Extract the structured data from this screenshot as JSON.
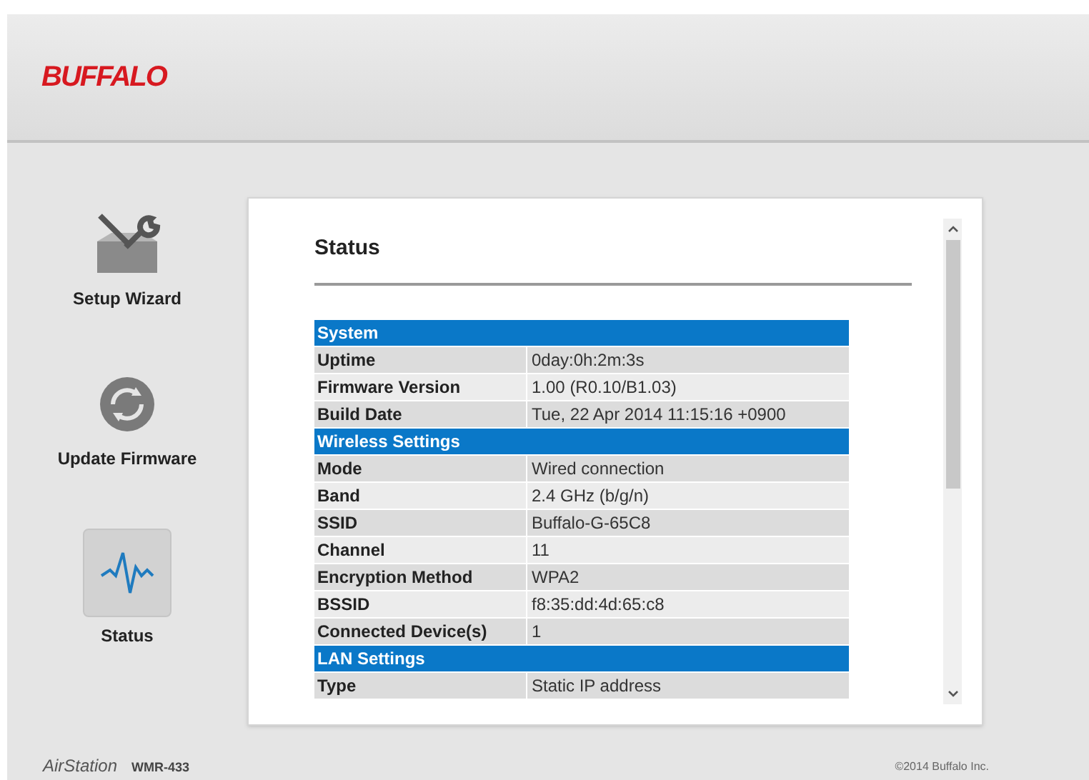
{
  "header": {
    "logo": "BUFFALO"
  },
  "sidebar": {
    "items": [
      {
        "label": "Setup Wizard",
        "kind": "wizard",
        "selected": false
      },
      {
        "label": "Update Firmware",
        "kind": "firmware",
        "selected": false
      },
      {
        "label": "Status",
        "kind": "status",
        "selected": true
      }
    ]
  },
  "content": {
    "title": "Status",
    "table": {
      "rows": [
        {
          "kind": "section",
          "label": "System"
        },
        {
          "kind": "item",
          "label": "Uptime",
          "value": "0day:0h:2m:3s"
        },
        {
          "kind": "item",
          "label": "Firmware Version",
          "value": "1.00 (R0.10/B1.03)"
        },
        {
          "kind": "item",
          "label": "Build Date",
          "value": "Tue, 22 Apr 2014 11:15:16 +0900"
        },
        {
          "kind": "section",
          "label": "Wireless Settings"
        },
        {
          "kind": "item",
          "label": "Mode",
          "value": "Wired connection"
        },
        {
          "kind": "item",
          "label": "Band",
          "value": "2.4 GHz (b/g/n)"
        },
        {
          "kind": "item",
          "label": "SSID",
          "value": "Buffalo-G-65C8"
        },
        {
          "kind": "item",
          "label": "Channel",
          "value": "11"
        },
        {
          "kind": "item",
          "label": "Encryption Method",
          "value": "WPA2"
        },
        {
          "kind": "item",
          "label": "BSSID",
          "value": "f8:35:dd:4d:65:c8"
        },
        {
          "kind": "item",
          "label": "Connected Device(s)",
          "value": "1"
        },
        {
          "kind": "section",
          "label": "LAN Settings"
        },
        {
          "kind": "item",
          "label": "Type",
          "value": "Static IP address"
        }
      ]
    }
  },
  "footer": {
    "product": "AirStation",
    "model": "WMR-433",
    "copyright": "©2014 Buffalo Inc."
  }
}
